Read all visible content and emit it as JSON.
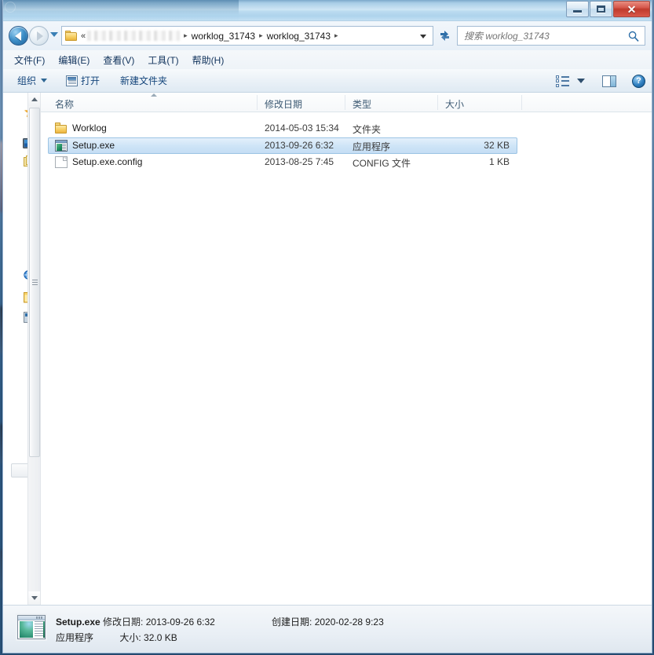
{
  "window": {
    "title": "",
    "controls": {
      "minimize": "—",
      "maximize": "□",
      "close": "✕"
    }
  },
  "addressbar": {
    "back_tooltip": "后退",
    "forward_tooltip": "前进",
    "folder_icon": "folder-icon",
    "double_chevron": "«",
    "redacted_segment": "",
    "segments": [
      "worklog_31743",
      "worklog_31743"
    ],
    "chevron": "▸",
    "dropdown": "▾",
    "refresh_icon": "refresh-icon"
  },
  "search": {
    "placeholder": "搜索 worklog_31743",
    "value": "",
    "icon": "search-icon"
  },
  "menubar": {
    "items": [
      {
        "label": "文件(F)"
      },
      {
        "label": "编辑(E)"
      },
      {
        "label": "查看(V)"
      },
      {
        "label": "工具(T)"
      },
      {
        "label": "帮助(H)"
      }
    ]
  },
  "commandbar": {
    "organize": "组织",
    "open": "打开",
    "new_folder": "新建文件夹",
    "view_icon": "list-view-icon",
    "view_caret": "▾",
    "preview_pane_icon": "preview-pane-icon",
    "help_icon": "help-icon",
    "help_glyph": "?"
  },
  "navpane": {
    "items": [
      {
        "icon": "favorites-star-icon",
        "label": ""
      },
      {
        "icon": "desktop-icon",
        "label": ""
      },
      {
        "icon": "libraries-icon",
        "label": ""
      },
      {
        "icon": "network-icon",
        "label": ""
      },
      {
        "icon": "folder-icon",
        "label": ""
      },
      {
        "icon": "computer-icon",
        "label": ""
      }
    ],
    "scrollbar": {
      "up_arrow": "▲",
      "down_arrow": "▼"
    }
  },
  "filelist": {
    "columns": [
      {
        "key": "name",
        "label": "名称"
      },
      {
        "key": "date",
        "label": "修改日期"
      },
      {
        "key": "type",
        "label": "类型"
      },
      {
        "key": "size",
        "label": "大小"
      }
    ],
    "sort": {
      "column": "名称",
      "direction": "asc"
    },
    "rows": [
      {
        "icon": "folder-icon",
        "name": "Worklog",
        "date": "2014-05-03 15:34",
        "type": "文件夹",
        "size": "",
        "selected": false
      },
      {
        "icon": "exe-file-icon",
        "name": "Setup.exe",
        "date": "2013-09-26 6:32",
        "type": "应用程序",
        "size": "32 KB",
        "selected": true
      },
      {
        "icon": "config-file-icon",
        "name": "Setup.exe.config",
        "date": "2013-08-25 7:45",
        "type": "CONFIG 文件",
        "size": "1 KB",
        "selected": false
      }
    ]
  },
  "statuspane": {
    "icon": "exe-preview-icon",
    "filename": "Setup.exe",
    "modified_label": "修改日期:",
    "modified_value": "2013-09-26 6:32",
    "created_label": "创建日期:",
    "created_value": "2020-02-28 9:23",
    "type_value": "应用程序",
    "size_label": "大小:",
    "size_value": "32.0 KB"
  },
  "colors": {
    "selection_fill": "#cfe5f7",
    "selection_border": "#9cc4e4",
    "titlebar_blue": "#aed3ec",
    "close_red": "#bf3b2d",
    "menu_text": "#11335c",
    "folder_yellow": "#f8d268"
  }
}
